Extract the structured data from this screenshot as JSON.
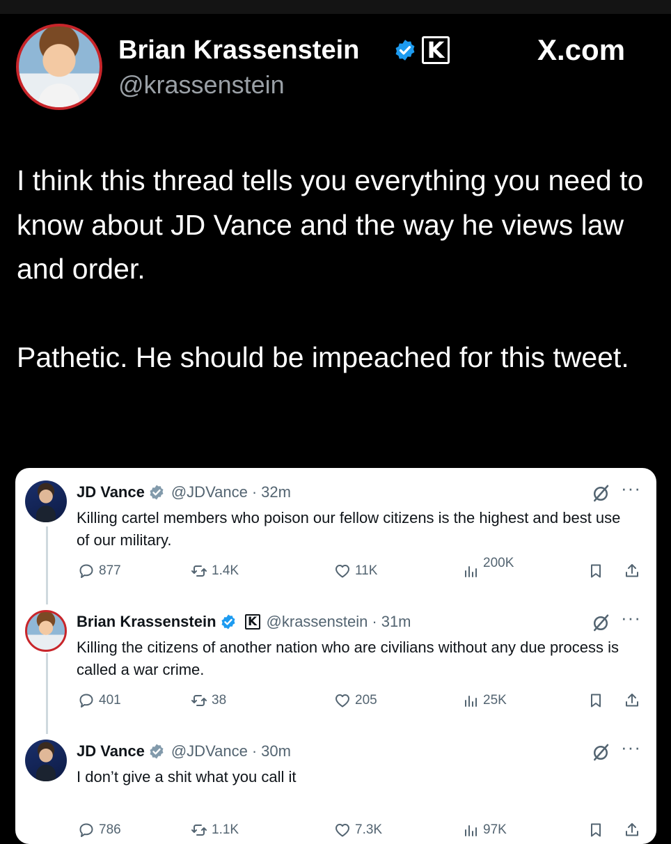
{
  "header": {
    "name": "Brian Krassenstein",
    "handle": "@krassenstein",
    "badge_icon": "verified-badge-icon",
    "k_badge_letter": "K",
    "watermark": "X.com"
  },
  "post": {
    "paragraphs": [
      "I think this thread tells you everything you need to know about JD Vance and the way he views law and order.",
      "Pathetic.  He should be impeached for this tweet."
    ]
  },
  "thread": [
    {
      "name": "JD Vance",
      "handle": "@JDVance",
      "separator": "·",
      "time": "32m",
      "text": "Killing cartel members who poison our fellow citizens is the highest and best use of our military.",
      "replies": "877",
      "reposts": "1.4K",
      "likes": "11K",
      "views": "200K"
    },
    {
      "name": "Brian Krassenstein",
      "handle": "@krassenstein",
      "k_badge": "K",
      "separator": "·",
      "time": "31m",
      "text": "Killing the citizens of another nation who are civilians without any due process is called a war crime.",
      "replies": "401",
      "reposts": "38",
      "likes": "205",
      "views": "25K"
    },
    {
      "name": "JD Vance",
      "handle": "@JDVance",
      "separator": "·",
      "time": "30m",
      "text": "I don’t give a shit what you call it",
      "replies": "786",
      "reposts": "1.1K",
      "likes": "7.3K",
      "views": "97K"
    }
  ],
  "more_label": "···",
  "colors": {
    "verified": "#1d9bf0",
    "muted": "#536471",
    "avatar_ring": "#c8252a"
  }
}
